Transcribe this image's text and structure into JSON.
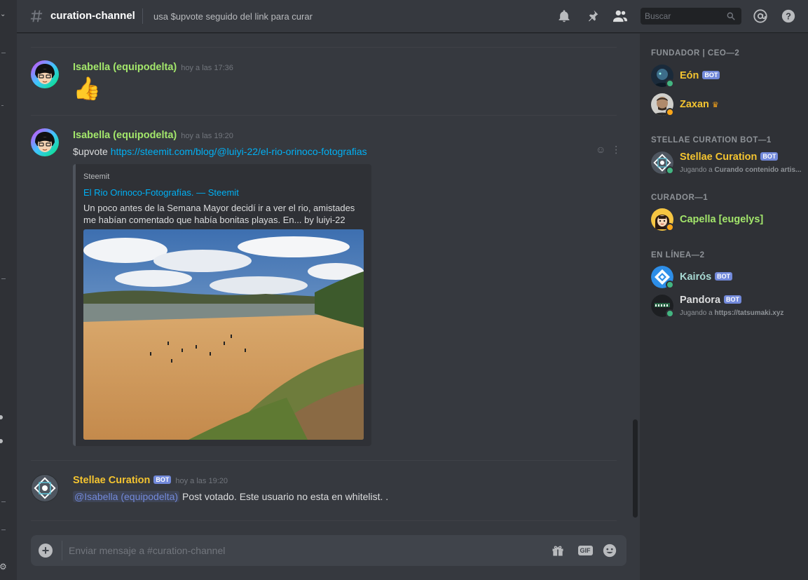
{
  "colors": {
    "green_name": "#a3e66b",
    "gold_name": "#f4c430",
    "teal_name": "#a7d9d3",
    "white_name": "#dcddde",
    "online": "#43b581",
    "idle": "#faa61a",
    "link": "#00b0f4",
    "bot_badge": "#7289da"
  },
  "header": {
    "channel_name": "curation-channel",
    "topic": "usa $upvote seguido del link para curar",
    "search_placeholder": "Buscar",
    "icons": [
      "bell-icon",
      "pin-icon",
      "members-icon",
      "search-icon",
      "mention-icon",
      "help-icon"
    ]
  },
  "messages": [
    {
      "author": "Isabella (equipodelta)",
      "timestamp": "hoy a las 17:36",
      "content": "👍"
    },
    {
      "author": "Isabella (equipodelta)",
      "timestamp": "hoy a las 19:20",
      "prefix": "$upvote ",
      "link": "https://steemit.com/blog/@luiyi-22/el-rio-orinoco-fotografias",
      "embed": {
        "provider": "Steemit",
        "title": "El Rio Orinoco-Fotografías. — Steemit",
        "description": "Un poco antes de la Semana Mayor decidí ir a ver el rio, amistades me habían comentado que había bonitas playas. En... by luiyi-22"
      }
    },
    {
      "author": "Stellae Curation",
      "bot_badge": "BOT",
      "timestamp": "hoy a las 19:20",
      "mention": "@Isabella (equipodelta)",
      "content": " Post votado. Este usuario no esta en whitelist. ."
    }
  ],
  "composer": {
    "placeholder": "Enviar mensaje a #curation-channel",
    "gif_label": "GIF"
  },
  "members": {
    "categories": [
      {
        "label": "FUNDADOR | CEO—2",
        "items": [
          {
            "name": "Eón",
            "badge": "BOT"
          },
          {
            "name": "Zaxan",
            "crown": "♛"
          }
        ]
      },
      {
        "label": "STELLAE CURATION BOT—1",
        "items": [
          {
            "name": "Stellae Curation",
            "badge": "BOT",
            "activity_prefix": "Jugando a ",
            "activity": "Curando contenido artis..."
          }
        ]
      },
      {
        "label": "CURADOR—1",
        "items": [
          {
            "name": "Capella [eugelys]"
          }
        ]
      },
      {
        "label": "EN LÍNEA—2",
        "items": [
          {
            "name": "Kairós",
            "badge": "BOT"
          },
          {
            "name": "Pandora",
            "badge": "BOT",
            "activity_prefix": "Jugando a ",
            "activity": "https://tatsumaki.xyz"
          }
        ]
      }
    ]
  }
}
